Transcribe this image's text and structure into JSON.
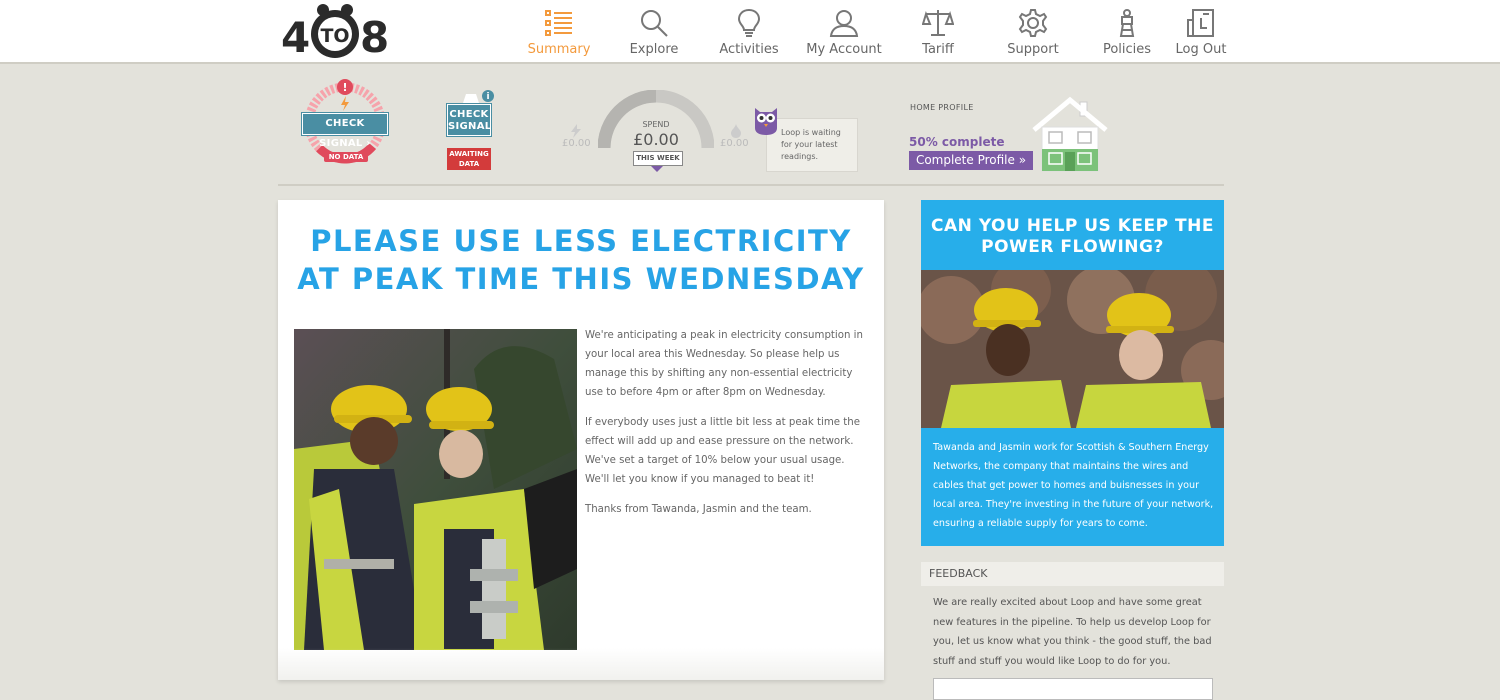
{
  "logo": {
    "left": "4",
    "middle": "TO",
    "right": "8"
  },
  "nav": [
    {
      "label": "Summary",
      "icon": "list-icon",
      "active": true
    },
    {
      "label": "Explore",
      "icon": "search-icon"
    },
    {
      "label": "Activities",
      "icon": "lightbulb-icon"
    },
    {
      "label": "My Account",
      "icon": "user-icon"
    },
    {
      "label": "Tariff",
      "icon": "scales-icon"
    },
    {
      "label": "Support",
      "icon": "gear-icon"
    },
    {
      "label": "Policies",
      "icon": "tower-icon"
    },
    {
      "label": "Log Out",
      "icon": "logout-icon"
    }
  ],
  "status": {
    "electricity": {
      "button": "CHECK SIGNAL",
      "tag": "NO DATA"
    },
    "gas": {
      "button_line1": "CHECK",
      "button_line2": "SIGNAL",
      "tag_line1": "AWAITING",
      "tag_line2": "DATA"
    },
    "spend": {
      "label": "SPEND",
      "value": "£0.00",
      "period": "THIS WEEK",
      "elec_value": "£0.00",
      "gas_value": "£0.00"
    },
    "owl_message": "Loop is waiting for your latest readings.",
    "home_profile": {
      "label": "HOME PROFILE",
      "complete": "50% complete",
      "button": "Complete Profile »",
      "percent": 50
    }
  },
  "article": {
    "title_line1": "PLEASE USE LESS ELECTRICITY",
    "title_line2": "AT PEAK TIME THIS WEDNESDAY",
    "paragraphs": [
      "We're anticipating a peak in electricity consumption in your local area this Wednesday. So please help us manage this by shifting any non-essential electricity use to before 4pm or after 8pm on Wednesday.",
      "If everybody uses just a little bit less at peak time the effect will add up and ease pressure on the network. We've set a target of 10% below your usual usage. We'll let you know if you managed to beat it!",
      "Thanks from Tawanda, Jasmin and the team."
    ]
  },
  "sidebar": {
    "title_line1": "CAN YOU HELP US KEEP THE",
    "title_line2": "POWER FLOWING?",
    "text": "Tawanda and Jasmin work for Scottish & Southern Energy Networks, the company that maintains the wires and cables that get power to homes and buisnesses in your local area. They're investing in the future of your network, ensuring a reliable supply for years to come."
  },
  "feedback": {
    "heading": "FEEDBACK",
    "text": "We are really excited about Loop and have some great new features in the pipeline. To help us develop Loop for you, let us know what you think - the good stuff, the bad stuff and stuff you would like Loop to do for you."
  },
  "colors": {
    "accent": "#27a3e6",
    "nav_active": "#f39a3d",
    "purple": "#7c5aa6",
    "alert": "#e04a5c",
    "house_green": "#7cc27a"
  }
}
